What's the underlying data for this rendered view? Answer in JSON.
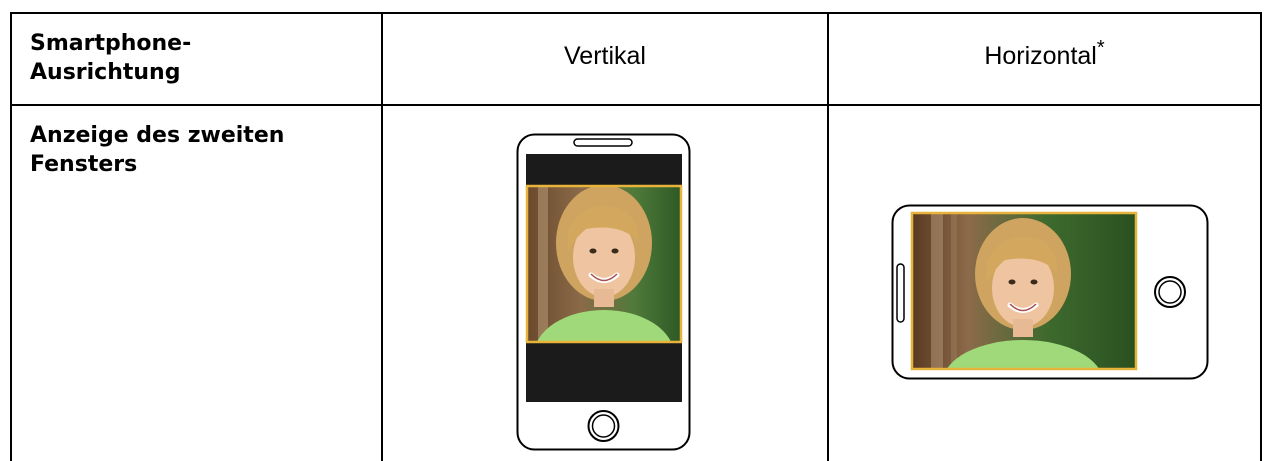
{
  "table": {
    "header": {
      "label_line1": "Smartphone-",
      "label_line2": "Ausrichtung",
      "col_vertical": "Vertikal",
      "col_horizontal": "Horizontal",
      "col_horizontal_footnote": "*"
    },
    "row": {
      "label_line1": "Anzeige des zweiten",
      "label_line2": "Fensters"
    }
  },
  "icons": {
    "vertical_phone": "smartphone-portrait-icon",
    "horizontal_phone": "smartphone-landscape-icon"
  },
  "colors": {
    "frame_highlight": "#e8b33a",
    "phone_outline": "#000000",
    "letterbox": "#1b1b1b",
    "shirt": "#9fd97a"
  }
}
